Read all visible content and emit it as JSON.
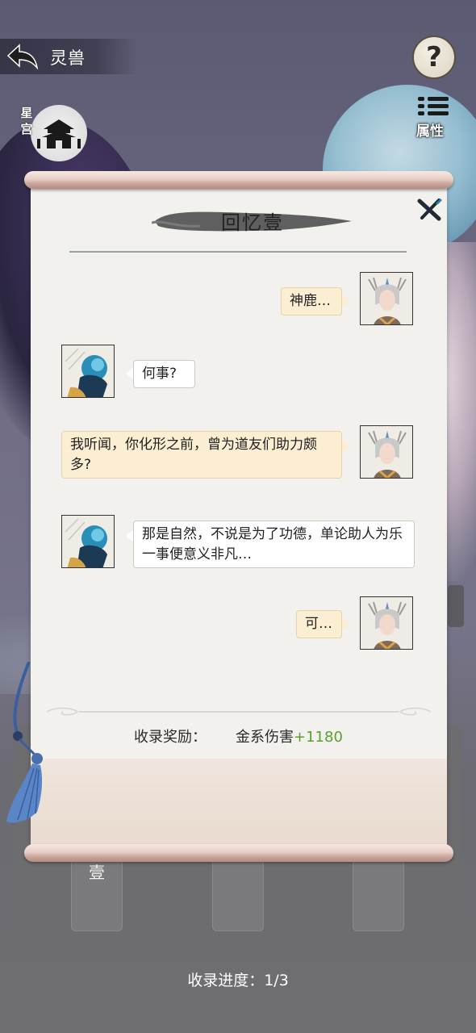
{
  "header": {
    "title": "灵兽",
    "help_label": "?",
    "attributes_label": "属性",
    "palace_label": "星宫"
  },
  "memory": {
    "title": "回忆壹",
    "dialogue": [
      {
        "speaker": "deer",
        "text": "神鹿…"
      },
      {
        "speaker": "beast",
        "text": "何事?"
      },
      {
        "speaker": "deer",
        "text": "我听闻，你化形之前，曾为道友们助力颇多?"
      },
      {
        "speaker": "beast",
        "text": "那是自然，不说是为了功德，单论助人为乐一事便意义非凡…"
      },
      {
        "speaker": "deer",
        "text": "可…"
      }
    ],
    "reward_label": "收录奖励：",
    "reward_name": "金系伤害",
    "reward_value": "+1180"
  },
  "collection": {
    "cards": [
      "壹",
      "",
      ""
    ],
    "progress_label": "收录进度：",
    "progress_value": "1/3"
  },
  "colors": {
    "reward_green": "#5aa02c",
    "user_bubble": "#fbeed2",
    "paper": "#f3f1ee"
  }
}
